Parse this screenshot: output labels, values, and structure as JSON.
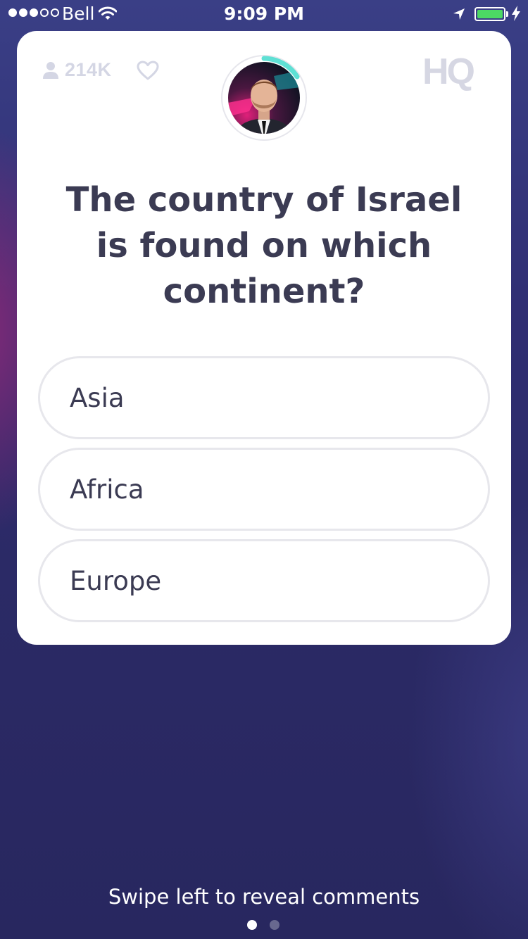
{
  "status_bar": {
    "carrier": "Bell",
    "time": "9:09 PM",
    "signal_bars_filled": 3,
    "signal_bars_total": 5,
    "battery_color": "#4cd964"
  },
  "header": {
    "viewer_count": "214K",
    "viewer_icon": "person-icon",
    "like_icon": "heart-icon",
    "logo_text": "HQ",
    "timer_ring_color": "#5ee0d4"
  },
  "question": {
    "text": "The country of Israel is found on which continent?"
  },
  "answers": [
    {
      "label": "Asia"
    },
    {
      "label": "Africa"
    },
    {
      "label": "Europe"
    }
  ],
  "footer": {
    "hint": "Swipe left to reveal comments",
    "pages_total": 2,
    "current_page": 1
  }
}
